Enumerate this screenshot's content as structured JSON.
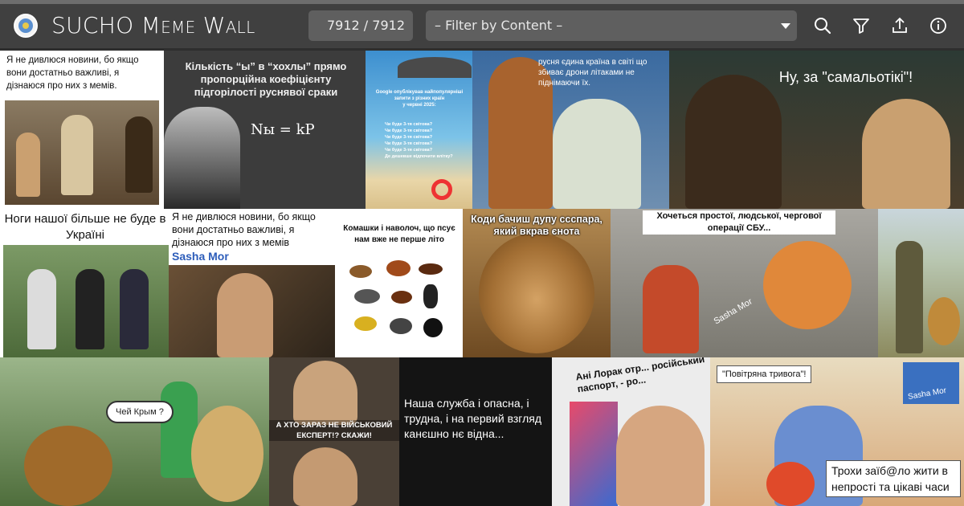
{
  "header": {
    "title_first": "SUCHO",
    "title_rest": "Meme Wall",
    "counter": "7912 / 7912",
    "filter_placeholder": "– Filter by Content –"
  },
  "colors": {
    "header_bg": "#404040",
    "control_bg": "#5f5f5f",
    "text_light": "#ffffff"
  },
  "icons": [
    "search-icon",
    "filter-icon",
    "upload-icon",
    "info-icon"
  ],
  "memes": {
    "m1": {
      "caption": "Я не дивлюся новини, бо якщо вони достатньо важливі, я дізнаюся про них з мемів."
    },
    "m2": {
      "caption": "Кількість “ы” в “хохлы” прямо пропорційна коефіцієнту підгорілості руснявої сраки",
      "formula": "Nы = kP"
    },
    "m3": {
      "caption_1": "Google опублікував найпопулярніші",
      "caption_2": "запити з різних країн",
      "caption_3": "у червні 2025:",
      "lines": [
        "Чи буде 3-тя світова?",
        "Чи буде 3-тя світова?",
        "Чи буде 3-тя світова?",
        "Чи буде 3-тя світова?",
        "Чи буде 3-тя світова?",
        "Де дешевше відпочити влітку?"
      ]
    },
    "m4": {
      "caption": "русня єдина країна в світі що збиває дрони літаками не піднімаючи їх."
    },
    "m5": {
      "caption": "Ну, за \"самальотікі\"!"
    },
    "m6": {
      "caption": "Ноги нашої більше не буде в Україні"
    },
    "m7": {
      "caption": "Я не дивлюся новини, бо якщо вони достатньо важливі, я дізнаюся про них з мемів",
      "signature": "Sasha Mor"
    },
    "m8": {
      "caption": "Комашки і наволоч, що псує нам вже не перше літо"
    },
    "m9": {
      "caption": "Коди бачиш дупу ссспара, який вкрав єнота"
    },
    "m10": {
      "caption": "Хочеться простої, людської, чергової операції СБУ...",
      "signature": "Sasha Mor"
    },
    "m12": {
      "bubble": "Чей Крым ?"
    },
    "m13": {
      "caption": "А ХТО ЗАРАЗ НЕ ВІЙСЬКОВИЙ ЕКСПЕРТ!? СКАЖИ!"
    },
    "m14": {
      "caption": "Наша служба і опасна, і трудна, і на первий взгляд канєшно нє відна..."
    },
    "m15": {
      "caption": "Ані Лорак отр... російський паспорт, - ро..."
    },
    "m16": {
      "bubble": "\"Повітряна тривога\"!",
      "signature": "Sasha Mor",
      "caption": "Трохи заїб@ло жити в непрості та цікаві часи"
    }
  }
}
